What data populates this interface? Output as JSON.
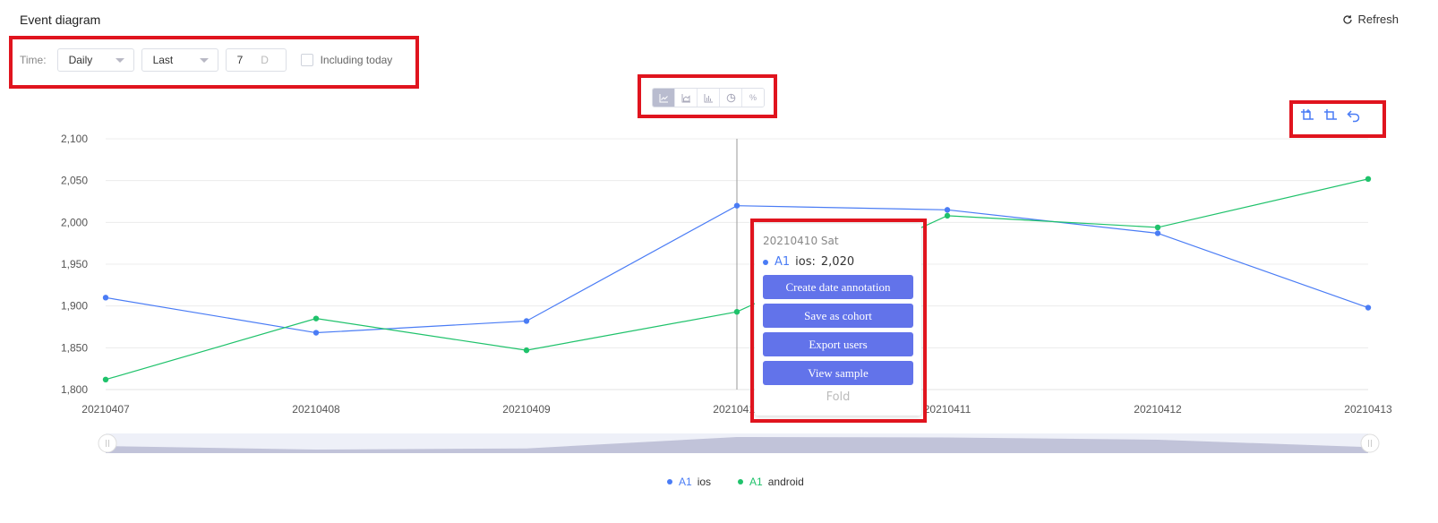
{
  "header": {
    "title": "Event diagram",
    "refresh_label": "Refresh"
  },
  "toolbar": {
    "time_label": "Time:",
    "granularity": "Daily",
    "range_mode": "Last",
    "range_value": "7",
    "range_unit": "D",
    "including_today_label": "Including today"
  },
  "chart_type_buttons": [
    {
      "icon": "line-chart-icon",
      "active": true
    },
    {
      "icon": "area-chart-icon",
      "active": false
    },
    {
      "icon": "bar-chart-icon",
      "active": false
    },
    {
      "icon": "pie-chart-icon",
      "active": false
    },
    {
      "icon": "percent-icon",
      "label": "%",
      "active": false
    }
  ],
  "chart_tools": [
    "zoom-in-select-icon",
    "zoom-reset-icon",
    "undo-icon"
  ],
  "colors": {
    "ios": "#4a7cf5",
    "android": "#1fc26b",
    "accent": "#6273ea",
    "highlight": "#e0141e"
  },
  "chart_data": {
    "type": "line",
    "x": [
      "20210407",
      "20210408",
      "20210409",
      "20210410",
      "20210411",
      "20210412",
      "20210413"
    ],
    "ylim": [
      1800,
      2100
    ],
    "yticks": [
      "1,800",
      "1,850",
      "1,900",
      "1,950",
      "2,000",
      "2,050",
      "2,100"
    ],
    "series": [
      {
        "name": "ios",
        "tag": "A1",
        "color": "#4a7cf5",
        "values": [
          1910,
          1868,
          1882,
          2020,
          2015,
          1987,
          1898
        ]
      },
      {
        "name": "android",
        "tag": "A1",
        "color": "#1fc26b",
        "values": [
          1812,
          1885,
          1847,
          1893,
          2008,
          1994,
          2052
        ]
      }
    ],
    "grid": true,
    "legend": "bottom-center"
  },
  "tooltip": {
    "date": "20210410 Sat",
    "series_tag": "A1",
    "series_name": "ios:",
    "value": "2,020",
    "actions": [
      "Create date annotation",
      "Save as cohort",
      "Export users",
      "View sample"
    ],
    "fold_label": "Fold"
  },
  "legend": [
    {
      "tag": "A1",
      "name": "ios",
      "color": "#4a7cf5"
    },
    {
      "tag": "A1",
      "name": "android",
      "color": "#1fc26b"
    }
  ]
}
